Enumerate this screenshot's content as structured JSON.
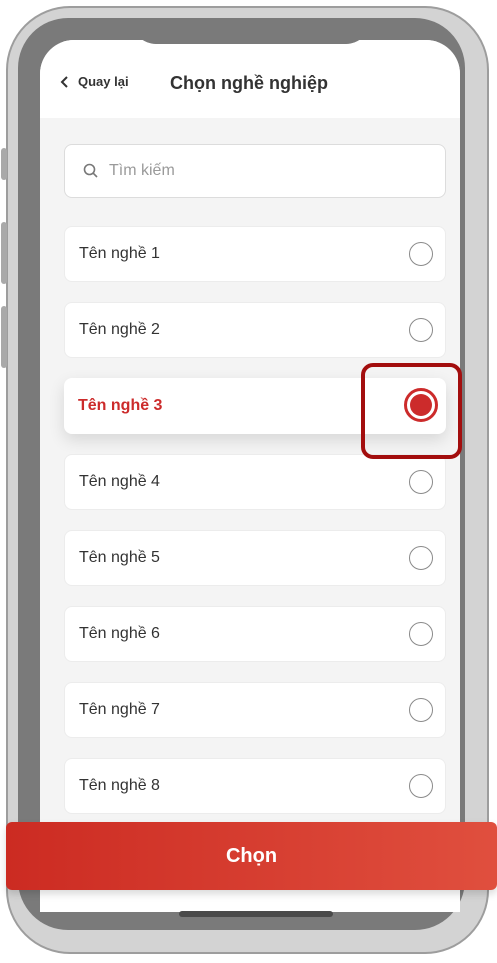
{
  "header": {
    "back_label": "Quay lại",
    "title": "Chọn nghề nghiệp"
  },
  "search": {
    "placeholder": "Tìm kiếm"
  },
  "items": [
    {
      "label": "Tên nghề 1",
      "selected": false
    },
    {
      "label": "Tên nghề 2",
      "selected": false
    },
    {
      "label": "Tên nghề 3",
      "selected": true
    },
    {
      "label": "Tên nghề 4",
      "selected": false
    },
    {
      "label": "Tên nghề 5",
      "selected": false
    },
    {
      "label": "Tên nghề 6",
      "selected": false
    },
    {
      "label": "Tên nghề 7",
      "selected": false
    },
    {
      "label": "Tên nghề 8",
      "selected": false
    }
  ],
  "cta": {
    "label": "Chọn"
  },
  "colors": {
    "accent": "#cc2b2b",
    "highlight": "#a30e0e"
  }
}
